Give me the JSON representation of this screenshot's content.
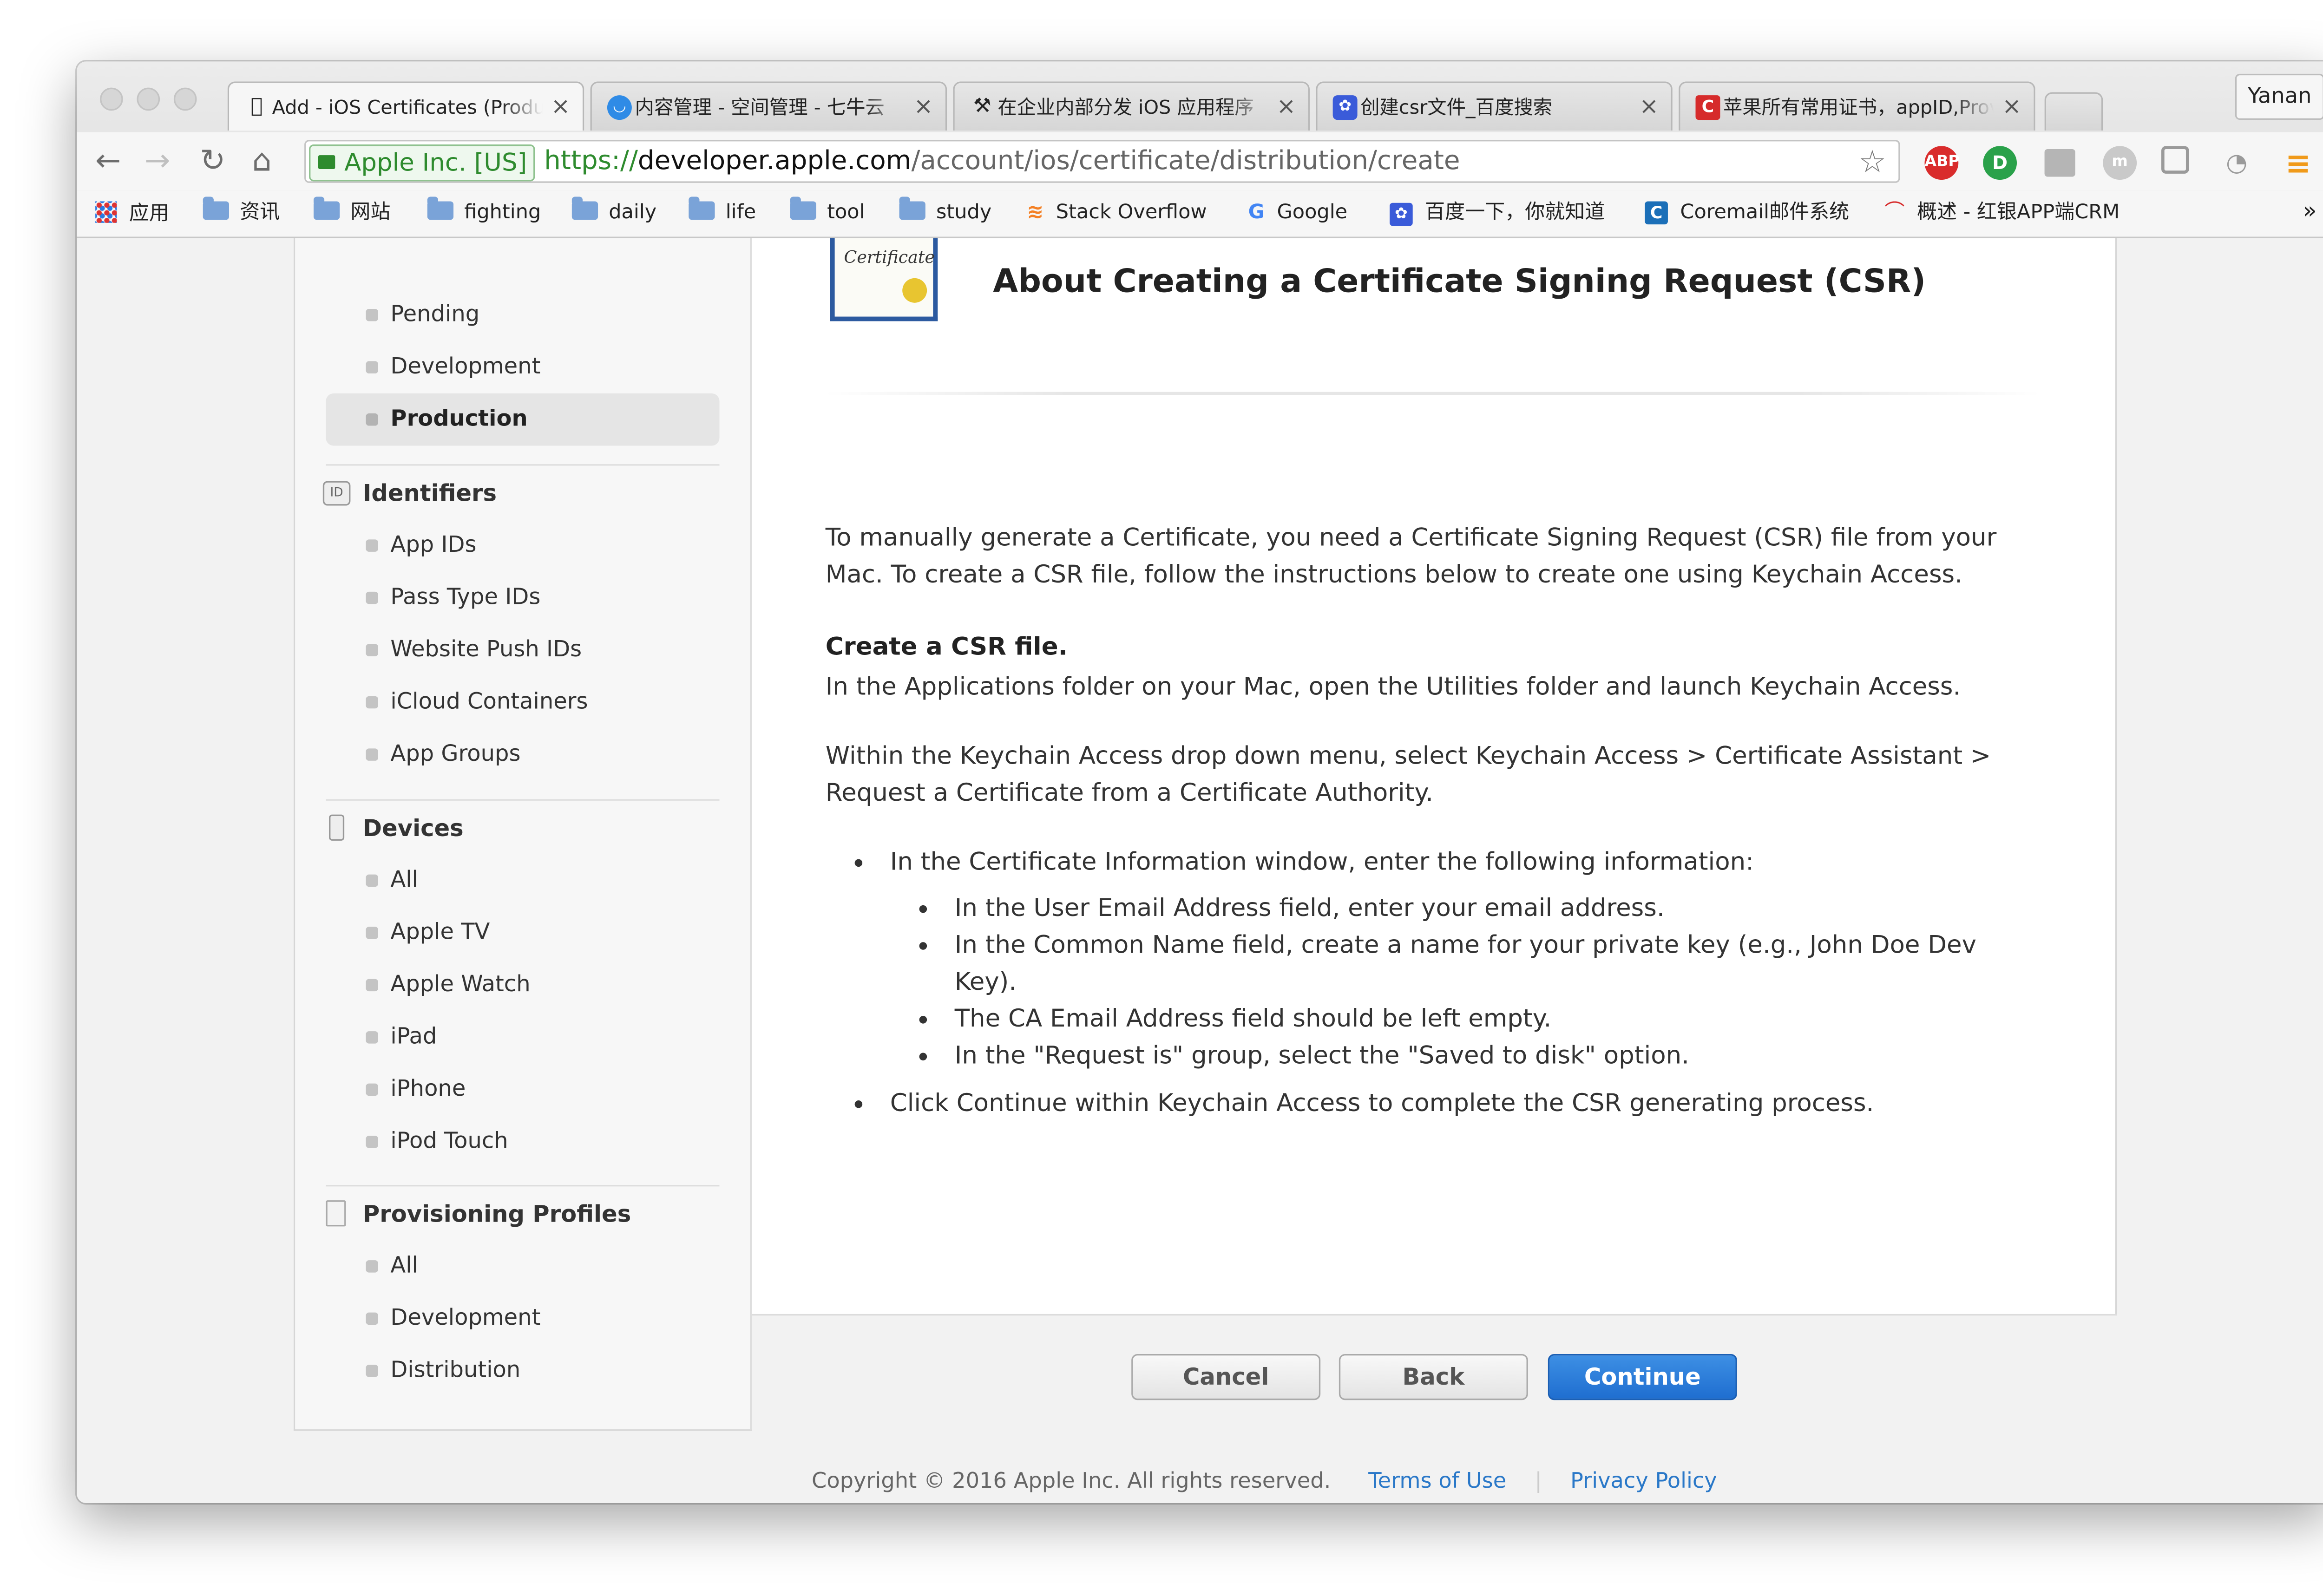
{
  "window": {
    "user_badge": "Yanan",
    "tabs": [
      {
        "title": "Add - iOS Certificates (Production)",
        "icon": "apple-icon",
        "active": true
      },
      {
        "title": "内容管理 - 空间管理 - 七牛云",
        "icon": "qiniu-icon",
        "active": false
      },
      {
        "title": "在企业内部分发 iOS 应用程序",
        "icon": "hammer-icon",
        "active": false
      },
      {
        "title": "创建csr文件_百度搜索",
        "icon": "baidu-icon",
        "active": false
      },
      {
        "title": "苹果所有常用证书，appID,Provisioning",
        "icon": "csdn-icon",
        "active": false
      }
    ]
  },
  "toolbar": {
    "secure_label": "Apple Inc. [US]",
    "url_scheme": "https://",
    "url_host": "developer.apple.com",
    "url_path": "/account/ios/certificate/distribution/create",
    "extensions": [
      "ABP"
    ]
  },
  "bookmarks": [
    {
      "label": "应用",
      "icon": "apps-grid-icon"
    },
    {
      "label": "资讯",
      "icon": "folder-icon"
    },
    {
      "label": "网站",
      "icon": "folder-icon"
    },
    {
      "label": "fighting",
      "icon": "folder-icon"
    },
    {
      "label": "daily",
      "icon": "folder-icon"
    },
    {
      "label": "life",
      "icon": "folder-icon"
    },
    {
      "label": "tool",
      "icon": "folder-icon"
    },
    {
      "label": "study",
      "icon": "folder-icon"
    },
    {
      "label": "Stack Overflow",
      "icon": "stackoverflow-icon"
    },
    {
      "label": "Google",
      "icon": "google-icon"
    },
    {
      "label": "百度一下，你就知道",
      "icon": "baidu-icon"
    },
    {
      "label": "Coremail邮件系统",
      "icon": "coremail-icon"
    },
    {
      "label": "概述 - 红银APP端CRM",
      "icon": "crm-icon"
    }
  ],
  "bookmarks_overflow": "»",
  "sidebar": {
    "certificates_items": [
      {
        "label": "Pending",
        "selected": false
      },
      {
        "label": "Development",
        "selected": false
      },
      {
        "label": "Production",
        "selected": true
      }
    ],
    "identifiers": {
      "title": "Identifiers",
      "badge": "ID",
      "items": [
        "App IDs",
        "Pass Type IDs",
        "Website Push IDs",
        "iCloud Containers",
        "App Groups"
      ]
    },
    "devices": {
      "title": "Devices",
      "items": [
        "All",
        "Apple TV",
        "Apple Watch",
        "iPad",
        "iPhone",
        "iPod Touch"
      ]
    },
    "profiles": {
      "title": "Provisioning Profiles",
      "items": [
        "All",
        "Development",
        "Distribution"
      ]
    }
  },
  "content": {
    "certificate_icon_text": "Certificate",
    "heading": "About Creating a Certificate Signing Request (CSR)",
    "intro": "To manually generate a Certificate, you need a Certificate Signing Request (CSR) file from your Mac. To create a CSR file, follow the instructions below to create one using Keychain Access.",
    "create_title": "Create a CSR file.",
    "create_text": "In the Applications folder on your Mac, open the Utilities folder and launch Keychain Access.",
    "menu_text": "Within the Keychain Access drop down menu, select Keychain Access > Certificate Assistant > Request a Certificate from a Certificate Authority.",
    "bullet1": "In the Certificate Information window, enter the following information:",
    "sub_bullets": [
      "In the User Email Address field, enter your email address.",
      "In the Common Name field, create a name for your private key (e.g., John Doe Dev Key).",
      "The CA Email Address field should be left empty.",
      "In the \"Request is\" group, select the \"Saved to disk\" option."
    ],
    "bullet2": "Click Continue within Keychain Access to complete the CSR generating process."
  },
  "actions": {
    "cancel": "Cancel",
    "back": "Back",
    "continue": "Continue"
  },
  "footer": {
    "copyright": "Copyright © 2016 Apple Inc. All rights reserved.",
    "terms": "Terms of Use",
    "privacy": "Privacy Policy"
  },
  "colors": {
    "accent_blue": "#1f6ed0",
    "link_blue": "#2a78c8",
    "secure_green": "#2e8b2e"
  }
}
